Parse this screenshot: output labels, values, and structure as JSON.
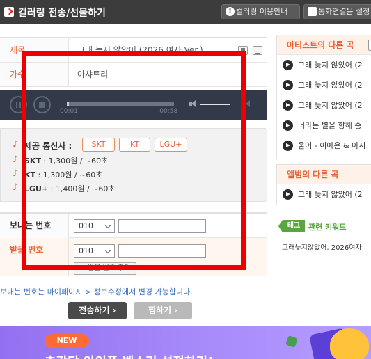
{
  "header": {
    "title": "컬러링 전송/선물하기",
    "help_label": "컬러링 이용안내",
    "call_label": "통화연결음 설정"
  },
  "form": {
    "title_label": "제목",
    "title_value": "그래 늦지 않았어 (2026 여자 Ver.)",
    "artist_label": "가수",
    "artist_value": "아샤트리"
  },
  "player": {
    "current_time": "00:01",
    "remaining_time": "-00:58",
    "progress": 0.02,
    "volume": 1.0
  },
  "carrier": {
    "label": "제공 통신사 :",
    "chips": [
      "SKT",
      "KT",
      "LGU+"
    ],
    "prices": [
      {
        "name": "SKT",
        "detail": " : 1,300원 / ~60초"
      },
      {
        "name": "KT",
        "detail": " : 1,300원 / ~60초"
      },
      {
        "name": "LGU+",
        "detail": " : 1,400원 / ~60초"
      }
    ]
  },
  "phone": {
    "sender_label": "보내는 번호",
    "receiver_label": "받을 번호",
    "prefix": "010",
    "add_button": "+ 받을 번호 추가"
  },
  "info_text": "보내는 번호는 마이페이지 > 정보수정에서 변경 가능합니다.",
  "actions": {
    "send": "전송하기 ›",
    "zzim": "찜하기 ›"
  },
  "sidebar": {
    "artist_title": "아티스트의 다른 곡",
    "artist_songs": [
      "그래 늦지 않았어 (2",
      "그래 늦지 않았어 (2",
      "그래 늦지 않았어 (2",
      "너라는 별을 향해 송",
      "울어 - 이예은 & 아시"
    ],
    "album_title": "앨범의 다른 곡",
    "album_songs": [
      "그래 늦지 않았어 (2"
    ],
    "tag_badge": "태그",
    "tag_title": "관련 키워드",
    "keywords": "그래늦지않았어, 2026여자"
  },
  "banner": {
    "new_badge": "NEW",
    "text": "초간단 아이폰 벨소리 설정하기!"
  },
  "colors": {
    "accent": "#e8623a",
    "topbar": "#3c3c3c",
    "player": "#323a4a",
    "highlight": "#ef0000",
    "tag": "#5aa63e"
  }
}
